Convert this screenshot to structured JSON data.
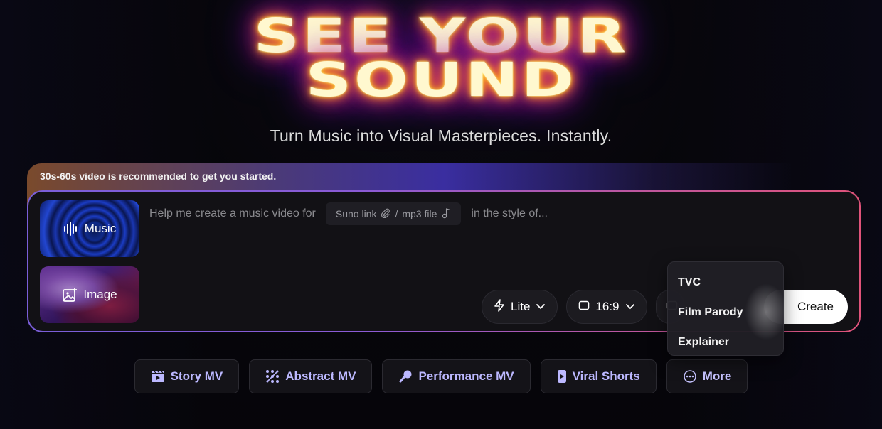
{
  "hero": {
    "title_line1": "SEE YOUR",
    "title_line2": "SOUND",
    "subtitle": "Turn Music into Visual Masterpieces. Instantly."
  },
  "notice": {
    "text": "30s-60s video is recommended to get you started."
  },
  "composer": {
    "cards": [
      {
        "label": "Music",
        "icon": "waveform-icon"
      },
      {
        "label": "Image",
        "icon": "add-image-icon"
      }
    ],
    "prompt_prefix": "Help me create a music video for",
    "source_chip": {
      "suno_label": "Suno link",
      "suno_icon": "paperclip-icon",
      "separator": "/",
      "mp3_label": "mp3 file",
      "mp3_icon": "music-note-icon"
    },
    "prompt_suffix": "in the style of...",
    "quality_select": {
      "value": "Lite",
      "icon": "lightning-icon"
    },
    "ratio_select": {
      "value": "16:9",
      "icon": "aspect-ratio-icon"
    },
    "create_label": "Create"
  },
  "dropdown": {
    "items": [
      "TVC",
      "Film Parody",
      "Explainer"
    ]
  },
  "presets": [
    {
      "label": "Story MV",
      "icon": "film-icon"
    },
    {
      "label": "Abstract MV",
      "icon": "abstract-icon"
    },
    {
      "label": "Performance MV",
      "icon": "microphone-icon"
    },
    {
      "label": "Viral Shorts",
      "icon": "phone-icon"
    },
    {
      "label": "More",
      "icon": "more-circle-icon"
    }
  ],
  "colors": {
    "accent": "#bcb8ff",
    "border_gradient_start": "#7a5ed8",
    "border_gradient_end": "#e0537a",
    "create_bg": "#ffffff",
    "title_glow": "#ff9a1c"
  }
}
